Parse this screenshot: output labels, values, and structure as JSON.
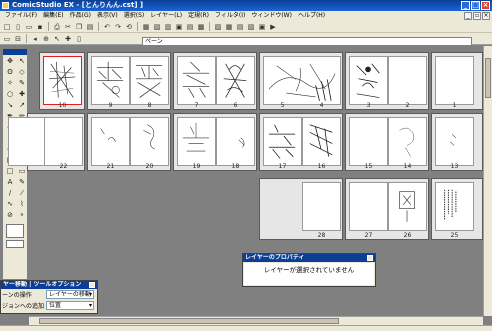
{
  "window": {
    "title": "ComicStudio EX - [とんりんん.cst] ]"
  },
  "menu": [
    "ファイル(F)",
    "編集(E)",
    "作品(G)",
    "表示(V)",
    "選択(S)",
    "レイヤー(L)",
    "定規(R)",
    "フィルタ(I)",
    "ウィンドウ(W)",
    "ヘルプ(H)"
  ],
  "tab": {
    "label": "ペーン"
  },
  "pages": [
    {
      "number": "10",
      "selected": true
    },
    {
      "number": "9",
      "selected": false
    },
    {
      "number": "8",
      "selected": false
    },
    {
      "number": "7",
      "selected": false
    },
    {
      "number": "6",
      "selected": false
    },
    {
      "number": "5",
      "selected": false
    },
    {
      "number": "4",
      "selected": false
    },
    {
      "number": "3",
      "selected": false
    },
    {
      "number": "2",
      "selected": false
    },
    {
      "number": "1",
      "selected": false
    },
    {
      "number": "22",
      "selected": false
    },
    {
      "number": "21",
      "selected": false
    },
    {
      "number": "20",
      "selected": false
    },
    {
      "number": "19",
      "selected": false
    },
    {
      "number": "18",
      "selected": false
    },
    {
      "number": "17",
      "selected": false
    },
    {
      "number": "16",
      "selected": false
    },
    {
      "number": "15",
      "selected": false
    },
    {
      "number": "14",
      "selected": false
    },
    {
      "number": "13",
      "selected": false
    },
    {
      "number": "28",
      "selected": false
    },
    {
      "number": "27",
      "selected": false
    },
    {
      "number": "26",
      "selected": false
    },
    {
      "number": "25",
      "selected": false
    }
  ],
  "layer_property": {
    "title": "レイヤーのプロパティ",
    "message": "レイヤーが選択されていません"
  },
  "tool_option": {
    "title": "ヤー移動 | ツールオプション",
    "row1_label": "ーンの操作",
    "row1_value": "レイヤーの移動",
    "row2_label": "ジョンへの追加",
    "row2_value": "位置"
  }
}
